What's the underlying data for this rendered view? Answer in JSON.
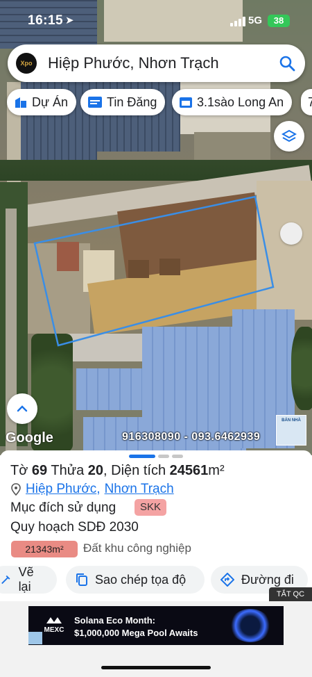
{
  "status_bar": {
    "time": "16:15",
    "network": "5G",
    "battery": "38"
  },
  "search": {
    "query": "Hiệp Phước, Nhơn Trạch",
    "logo_text": "Xpo"
  },
  "chips": [
    {
      "label": "Dự Án",
      "icon": "building-icon"
    },
    {
      "label": "Tin Đăng",
      "icon": "listing-icon"
    },
    {
      "label": "3.1sào Long An",
      "icon": "calendar-icon"
    },
    {
      "label": "7",
      "icon": ""
    }
  ],
  "map": {
    "attribution": "Google",
    "overlay_phones": "916308090 - 093.6462939",
    "ad_thumb_text": "BÁN NHÀ"
  },
  "parcel": {
    "label_to": "Tờ",
    "to": "69",
    "label_thua": "Thửa",
    "thua": "20",
    "label_area": "Diện tích",
    "area": "24561",
    "area_unit": "m²",
    "ward": "Hiệp Phước",
    "district": "Nhơn Trạch",
    "purpose_label": "Mục đích sử dụng",
    "purpose_code": "SKK",
    "planning_label": "Quy hoạch SDĐ 2030",
    "planning_area": "21343m²",
    "planning_type": "Đất khu công nghiệp"
  },
  "actions": [
    {
      "label": "Vẽ lại",
      "icon": "redraw-icon"
    },
    {
      "label": "Sao chép tọa độ",
      "icon": "copy-icon"
    },
    {
      "label": "Đường đi",
      "icon": "directions-icon"
    }
  ],
  "ad": {
    "close_label": "TẮT QC",
    "brand": "MEXC",
    "title": "Solana Eco Month:",
    "subtitle": "$1,000,000 Mega Pool Awaits"
  },
  "colors": {
    "accent": "#1a73e8",
    "parcel_outline": "#3a8ee6",
    "badge": "#f4a3a3",
    "planning_pill": "#e98b84"
  }
}
